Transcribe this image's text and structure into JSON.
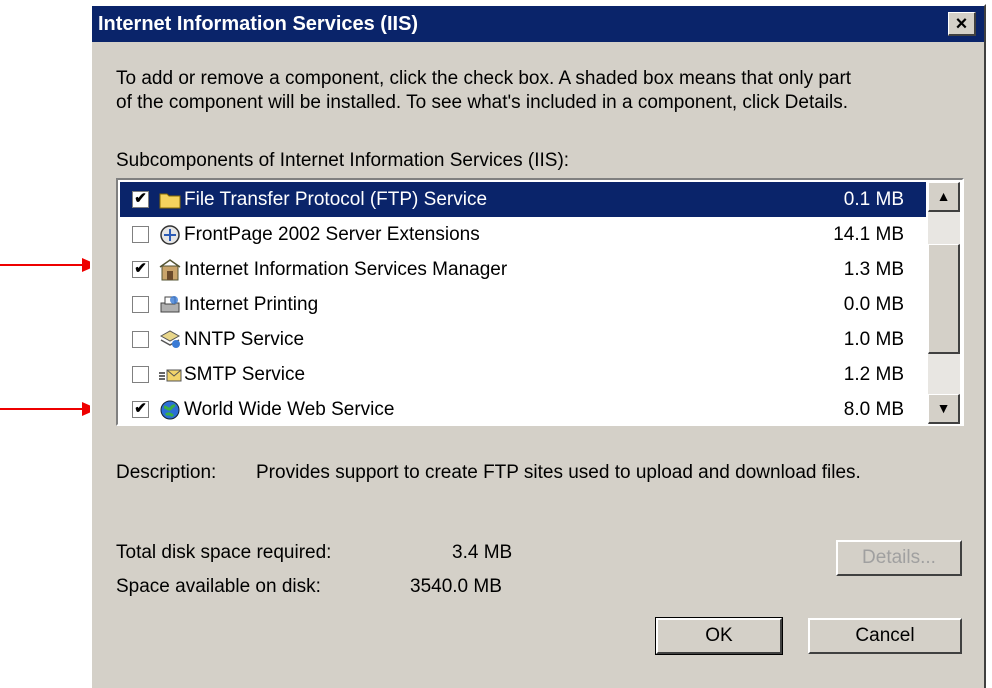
{
  "title": "Internet Information Services (IIS)",
  "close_glyph": "×",
  "instructions_line1": "To add or remove a component, click the check box. A shaded box means that only part",
  "instructions_line2": "of the component will be installed. To see what's included in a component, click Details.",
  "list_label": "Subcomponents of Internet Information Services (IIS):",
  "components": [
    {
      "label": "File Transfer Protocol (FTP) Service",
      "size": "0.1 MB",
      "checked": true,
      "selected": true,
      "icon": "folder-icon"
    },
    {
      "label": "FrontPage 2002 Server Extensions",
      "size": "14.1 MB",
      "checked": false,
      "selected": false,
      "icon": "frontpage-icon"
    },
    {
      "label": "Internet Information Services Manager",
      "size": "1.3 MB",
      "checked": true,
      "selected": false,
      "icon": "iis-manager-icon"
    },
    {
      "label": "Internet Printing",
      "size": "0.0 MB",
      "checked": false,
      "selected": false,
      "icon": "printer-icon"
    },
    {
      "label": "NNTP Service",
      "size": "1.0 MB",
      "checked": false,
      "selected": false,
      "icon": "news-icon"
    },
    {
      "label": "SMTP Service",
      "size": "1.2 MB",
      "checked": false,
      "selected": false,
      "icon": "mail-icon"
    },
    {
      "label": "World Wide Web Service",
      "size": "8.0 MB",
      "checked": true,
      "selected": false,
      "icon": "globe-icon"
    }
  ],
  "check_glyph": "✔",
  "scroll_up_glyph": "▲",
  "scroll_down_glyph": "▼",
  "description_label": "Description:",
  "description_text": "Provides support to create FTP sites used to upload and download files.",
  "total_disk_label": "Total disk space required:",
  "total_disk_value": "3.4 MB",
  "available_label": "Space available on disk:",
  "available_value": "3540.0 MB",
  "details_button": "Details...",
  "ok_button": "OK",
  "cancel_button": "Cancel",
  "colors": {
    "titlebar": "#0a246a",
    "face": "#d4d0c8",
    "annotation_arrow": "#ee0000"
  }
}
